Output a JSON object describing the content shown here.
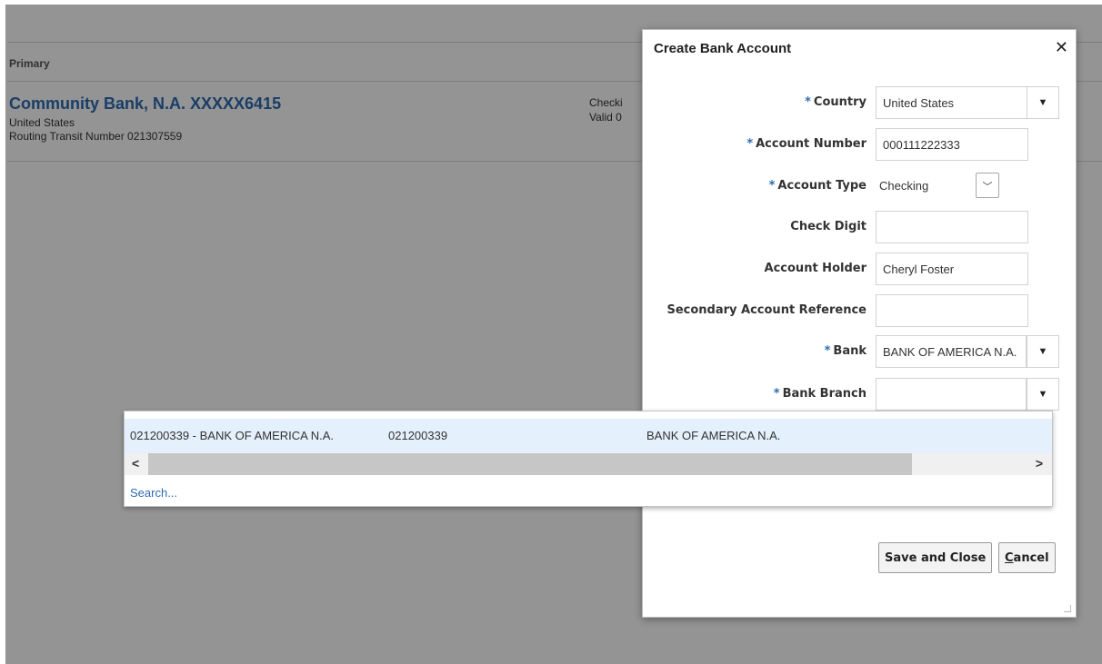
{
  "background": {
    "header_label": "Primary",
    "account": {
      "name": "Community Bank, N.A. XXXXX6415",
      "country": "United States",
      "routing": "Routing Transit Number 021307559",
      "type": "Checki",
      "valid": "Valid 0"
    }
  },
  "dialog": {
    "title": "Create Bank Account",
    "close_icon": "close-icon",
    "fields": {
      "country": {
        "label": "Country",
        "required": true,
        "value": "United States"
      },
      "account_number": {
        "label": "Account Number",
        "required": true,
        "value": "000111222333"
      },
      "account_type": {
        "label": "Account Type",
        "required": true,
        "value": "Checking"
      },
      "check_digit": {
        "label": "Check Digit",
        "required": false,
        "value": ""
      },
      "account_holder": {
        "label": "Account Holder",
        "required": false,
        "value": "Cheryl Foster"
      },
      "secondary_ref": {
        "label": "Secondary Account Reference",
        "required": false,
        "value": ""
      },
      "bank": {
        "label": "Bank",
        "required": true,
        "value": "BANK OF AMERICA N.A."
      },
      "bank_branch": {
        "label": "Bank Branch",
        "required": true,
        "value": ""
      }
    },
    "required_marker": "*",
    "buttons": {
      "save_close": "Save and Close",
      "cancel_first": "C",
      "cancel_rest": "ancel"
    }
  },
  "branch_popup": {
    "rows": [
      {
        "display": "021200339 - BANK OF AMERICA N.A.",
        "number": "021200339",
        "bank": "BANK OF AMERICA N.A."
      }
    ],
    "scroll_left": "<",
    "scroll_right": ">",
    "search_link": "Search..."
  },
  "colors": {
    "accent": "#2d6bb0",
    "highlight_row": "#e4f0fb",
    "overlay": "rgba(0,0,0,0.42)"
  }
}
